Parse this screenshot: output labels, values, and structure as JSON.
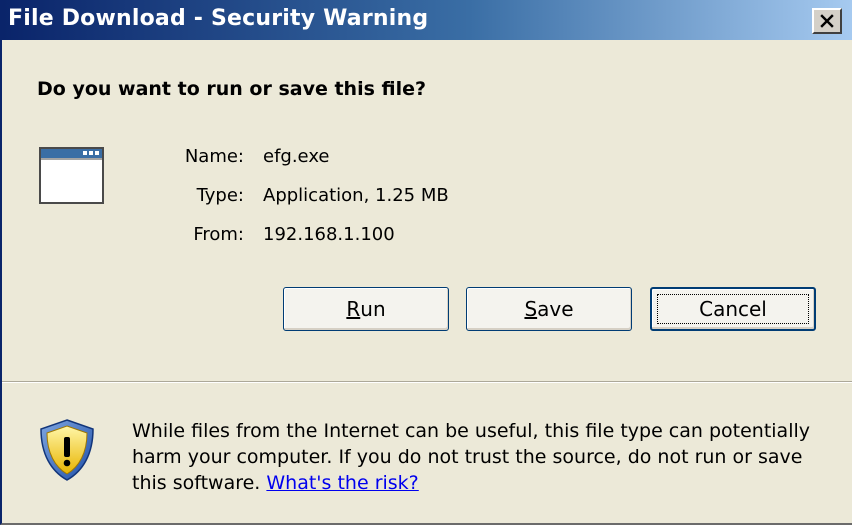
{
  "window": {
    "title": "File Download - Security Warning"
  },
  "dialog": {
    "question": "Do you want to run or save this file?",
    "name_label": "Name:",
    "name_value": "efg.exe",
    "type_label": "Type:",
    "type_value": "Application, 1.25 MB",
    "from_label": "From:",
    "from_value": "192.168.1.100"
  },
  "buttons": {
    "run": {
      "mnemonic": "R",
      "rest": "un"
    },
    "save": {
      "mnemonic": "S",
      "rest": "ave"
    },
    "cancel": "Cancel"
  },
  "warning": {
    "text": "While files from the Internet can be useful, this file type can potentially harm your computer. If you do not trust the source, do not run or save this software.",
    "link_text": "What's the risk?"
  },
  "icons": {
    "close": "close-icon",
    "application": "application-window-icon",
    "warning": "shield-warning-icon"
  },
  "colors": {
    "titlebar_start": "#0a246a",
    "titlebar_end": "#a6caf0",
    "dialog_bg": "#ece9d8",
    "link": "#0000ee"
  }
}
